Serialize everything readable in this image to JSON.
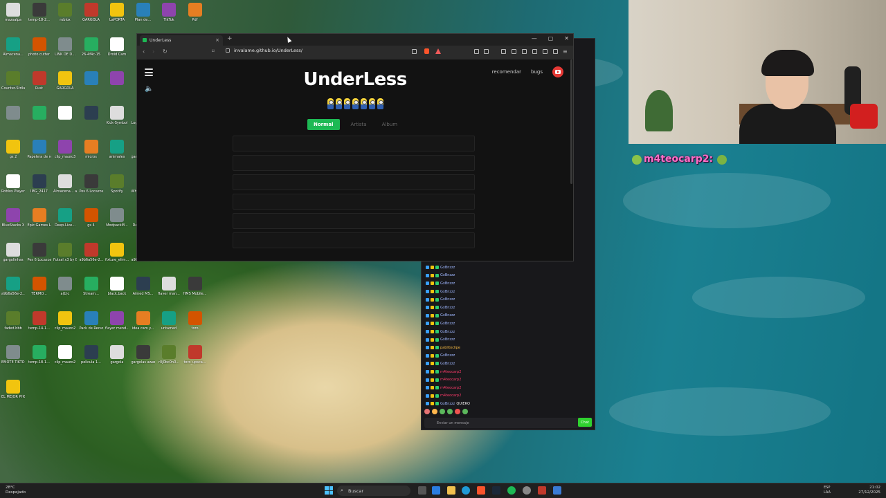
{
  "desktop": {
    "icons": [
      "mazsalpa",
      "temp-18-2...",
      "roblox",
      "GARGOLA",
      "LaPORTA",
      "Plan de...",
      "TikTok",
      "Pdf",
      "Almacena...",
      "photo cutter",
      "LINK DE D...",
      "26-4f4c-15",
      "Droid Cam",
      "Epic",
      "e6f2156e",
      "temp-18-2...",
      "Counter-Strike",
      "Rust",
      "GARGOLA",
      "",
      "",
      "",
      "",
      "",
      "",
      "",
      "",
      "",
      "Kick-Symbol",
      "Logitech G Hub",
      "temp-7-23-...",
      "tennis",
      "gs 2",
      "Papelera de reciclaje",
      "clip_mauro3",
      "micros",
      "animales",
      "gargolas awards",
      "Pro Evolution Soccer 6",
      "Fortnite",
      "Roblox Player",
      "IMG_2417",
      "Almacena... automatic...",
      "Pes 6 Locazos",
      "Spotify",
      "WhatsApp Video",
      "Pixel-Nest",
      "Captura de pantalla",
      "BlueStacks X",
      "Epic Games Launcher",
      "Deep-Live...",
      "gs 4",
      "ModpackM...",
      "Deep-Live...",
      "Microsoft Edge",
      "OIP",
      "gargolinhas",
      "Pes 6 Locazos",
      "Futsal x3 by Bazinga Fro...",
      "a9b6a56e-2...",
      "fixture_elim...",
      "a9b6a56e-2...",
      "Ellen Vatica...",
      "Extension",
      "a9b6a56e-2...",
      "TERMO...",
      "a(b)c",
      "Stream...",
      "black.back",
      "Aimed MS...",
      "flayer man...",
      "HMS Mobile...",
      "faded.bbb",
      "temp-14-1...",
      "clip_mauro2",
      "Pack de Recursos",
      "flayer mend...",
      "idea cam y...",
      "untamed",
      "toro",
      "EMOTE TIKTOK",
      "temp-18-1...",
      "clip_mauro2",
      "pelicula 1...",
      "gargola",
      "gargolas awards",
      "r0j0bc0n0...",
      "toro_upsca...",
      "EL MEJOR PHONE"
    ]
  },
  "browser": {
    "tab_title": "UnderLess",
    "tab_close": "×",
    "new_tab": "+",
    "url": "invalame.github.io/UnderLess/",
    "window_controls": [
      "—",
      "▢",
      "✕"
    ]
  },
  "page": {
    "brand": "UnderLess",
    "top_links": [
      "recomendar",
      "bugs"
    ],
    "modes": [
      {
        "label": "Normal",
        "active": true
      },
      {
        "label": "Artista",
        "active": false
      },
      {
        "label": "Album",
        "active": false
      }
    ],
    "result_slots": 6
  },
  "chat": {
    "input_placeholder": "Enviar un mensaje",
    "chat_button": "Chat",
    "lines": [
      {
        "user": "GxBnzzz",
        "text": ""
      },
      {
        "user": "GxBnzzz",
        "text": ""
      },
      {
        "user": "GxBnzzz",
        "text": ""
      },
      {
        "user": "GxBnzzz",
        "text": ""
      },
      {
        "user": "GxBnzzz",
        "text": ""
      },
      {
        "user": "GxBnzzz",
        "text": ""
      },
      {
        "user": "GxBnzzz",
        "text": ""
      },
      {
        "user": "GxBnzzz",
        "text": ""
      },
      {
        "user": "GxBnzzz",
        "text": ""
      },
      {
        "user": "GxBnzzz",
        "text": ""
      },
      {
        "user": "pablitoclipe",
        "text": ""
      },
      {
        "user": "GxBnzzz",
        "text": ""
      },
      {
        "user": "GxBnzzz",
        "text": ""
      },
      {
        "user": "m4teocarp2",
        "text": ""
      },
      {
        "user": "m4teocarp2",
        "text": ""
      },
      {
        "user": "m4teocarp2",
        "text": ""
      },
      {
        "user": "m4teocarp2",
        "text": ""
      },
      {
        "user": "GxBnzzz",
        "text": "QUIERO"
      }
    ]
  },
  "overlay": {
    "username": "m4teocarp2:"
  },
  "taskbar": {
    "weather_temp": "28°C",
    "weather_desc": "Despejado",
    "search_label": "Buscar",
    "lang_top": "ESP",
    "lang_bottom": "LAA",
    "time": "21:02",
    "date": "27/12/2025"
  },
  "colors": {
    "accent_green": "#1db954",
    "youtube_red": "#e53935",
    "overlay_pink": "#ff6ec7"
  }
}
